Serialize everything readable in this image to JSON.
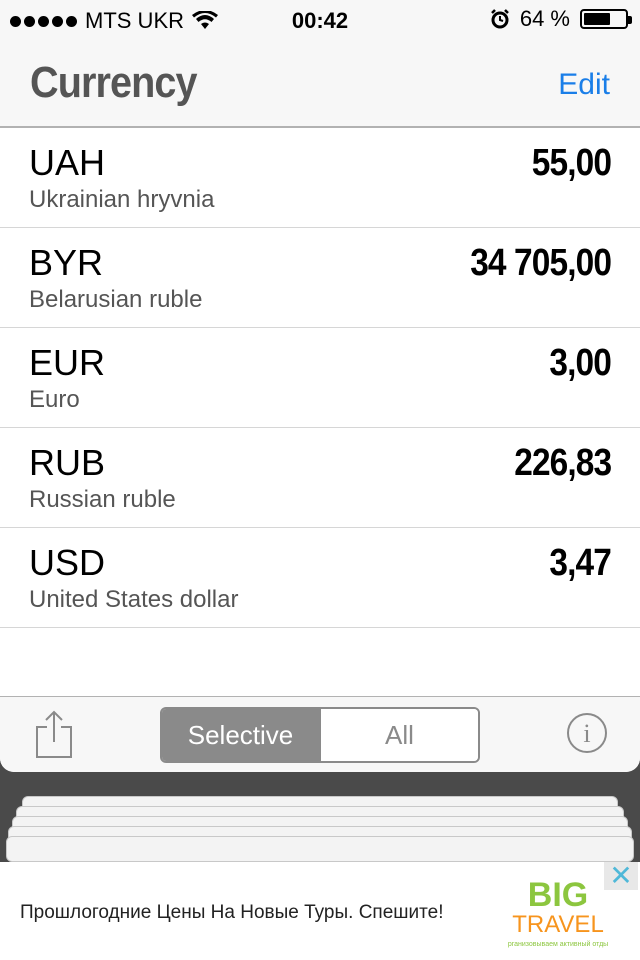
{
  "status": {
    "carrier": "MTS UKR",
    "time": "00:42",
    "battery": "64 %",
    "battery_level": 0.64
  },
  "nav": {
    "title": "Currency",
    "edit": "Edit"
  },
  "currencies": [
    {
      "code": "UAH",
      "name": "Ukrainian hryvnia",
      "value": "55,00"
    },
    {
      "code": "BYR",
      "name": "Belarusian ruble",
      "value": "34 705,00"
    },
    {
      "code": "EUR",
      "name": "Euro",
      "value": "3,00"
    },
    {
      "code": "RUB",
      "name": "Russian ruble",
      "value": "226,83"
    },
    {
      "code": "USD",
      "name": "United States dollar",
      "value": "3,47"
    }
  ],
  "toolbar": {
    "share_icon": "share-icon",
    "segments": [
      "Selective",
      "All"
    ],
    "selected": "Selective",
    "info_icon": "info-icon"
  },
  "ad": {
    "text": "Прошлогодние Цены На Новые Туры. Спешите!",
    "logo_top": "BIG",
    "logo_bottom": "TRAVEL",
    "logo_tagline": "Организовываем активный отдых!",
    "close": "✕",
    "colors": {
      "big": "#8cc63f",
      "travel": "#f7941d"
    }
  }
}
